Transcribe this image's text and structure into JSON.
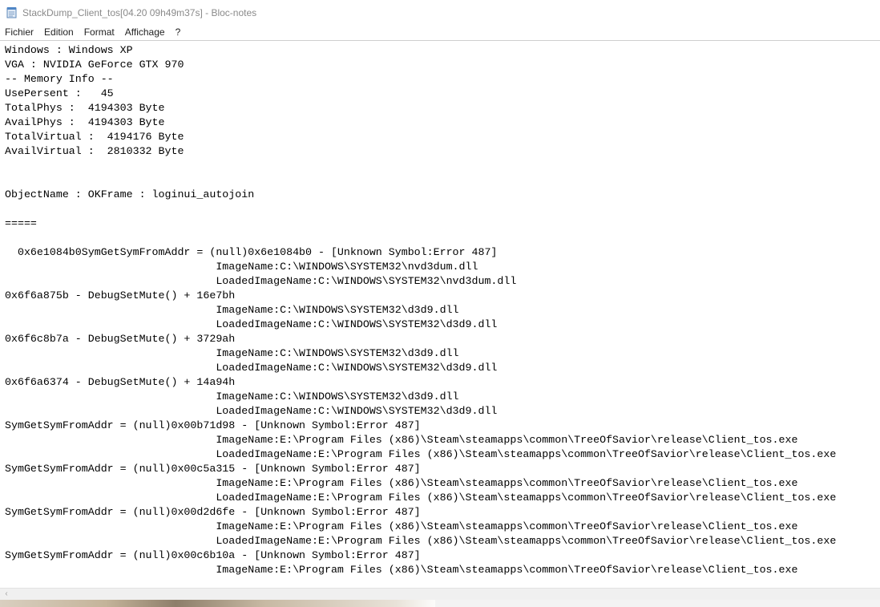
{
  "window": {
    "title": "StackDump_Client_tos[04.20 09h49m37s] - Bloc-notes",
    "app_icon": "notepad-icon"
  },
  "menu": {
    "items": [
      "Fichier",
      "Edition",
      "Format",
      "Affichage",
      "?"
    ]
  },
  "document": {
    "lines": [
      "Windows : Windows XP",
      "VGA : NVIDIA GeForce GTX 970",
      "-- Memory Info --",
      "UsePersent :   45",
      "TotalPhys :  4194303 Byte",
      "AvailPhys :  4194303 Byte",
      "TotalVirtual :  4194176 Byte",
      "AvailVirtual :  2810332 Byte",
      "",
      "",
      "ObjectName : OKFrame : loginui_autojoin",
      "",
      "=====",
      "",
      "  0x6e1084b0SymGetSymFromAddr = (null)0x6e1084b0 - [Unknown Symbol:Error 487]",
      "                                 ImageName:C:\\WINDOWS\\SYSTEM32\\nvd3dum.dll",
      "                                 LoadedImageName:C:\\WINDOWS\\SYSTEM32\\nvd3dum.dll",
      "0x6f6a875b - DebugSetMute() + 16e7bh",
      "                                 ImageName:C:\\WINDOWS\\SYSTEM32\\d3d9.dll",
      "                                 LoadedImageName:C:\\WINDOWS\\SYSTEM32\\d3d9.dll",
      "0x6f6c8b7a - DebugSetMute() + 3729ah",
      "                                 ImageName:C:\\WINDOWS\\SYSTEM32\\d3d9.dll",
      "                                 LoadedImageName:C:\\WINDOWS\\SYSTEM32\\d3d9.dll",
      "0x6f6a6374 - DebugSetMute() + 14a94h",
      "                                 ImageName:C:\\WINDOWS\\SYSTEM32\\d3d9.dll",
      "                                 LoadedImageName:C:\\WINDOWS\\SYSTEM32\\d3d9.dll",
      "SymGetSymFromAddr = (null)0x00b71d98 - [Unknown Symbol:Error 487]",
      "                                 ImageName:E:\\Program Files (x86)\\Steam\\steamapps\\common\\TreeOfSavior\\release\\Client_tos.exe",
      "                                 LoadedImageName:E:\\Program Files (x86)\\Steam\\steamapps\\common\\TreeOfSavior\\release\\Client_tos.exe",
      "SymGetSymFromAddr = (null)0x00c5a315 - [Unknown Symbol:Error 487]",
      "                                 ImageName:E:\\Program Files (x86)\\Steam\\steamapps\\common\\TreeOfSavior\\release\\Client_tos.exe",
      "                                 LoadedImageName:E:\\Program Files (x86)\\Steam\\steamapps\\common\\TreeOfSavior\\release\\Client_tos.exe",
      "SymGetSymFromAddr = (null)0x00d2d6fe - [Unknown Symbol:Error 487]",
      "                                 ImageName:E:\\Program Files (x86)\\Steam\\steamapps\\common\\TreeOfSavior\\release\\Client_tos.exe",
      "                                 LoadedImageName:E:\\Program Files (x86)\\Steam\\steamapps\\common\\TreeOfSavior\\release\\Client_tos.exe",
      "SymGetSymFromAddr = (null)0x00c6b10a - [Unknown Symbol:Error 487]",
      "                                 ImageName:E:\\Program Files (x86)\\Steam\\steamapps\\common\\TreeOfSavior\\release\\Client_tos.exe"
    ]
  },
  "scrollbar": {
    "left_arrow": "‹"
  }
}
